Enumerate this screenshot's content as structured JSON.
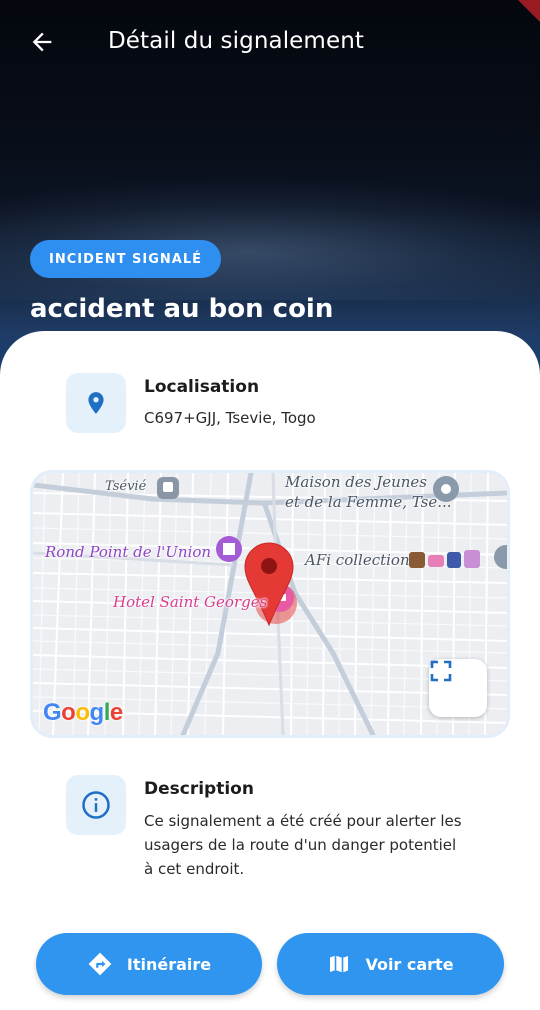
{
  "appbar": {
    "title": "Détail du signalement"
  },
  "hero": {
    "badge": "INCIDENT SIGNALÉ",
    "title": "accident au bon coin"
  },
  "location": {
    "heading": "Localisation",
    "address": "C697+GJJ, Tsevie, Togo"
  },
  "map": {
    "labels": {
      "tsevie": "Tsévié",
      "maison_line1": "Maison des Jeunes",
      "maison_line2": "et de la Femme, Tse...",
      "rond_point": "Rond Point de l'Union",
      "afi": "AFi collection",
      "hotel": "Hotel Saint Georges"
    },
    "google_logo": "Google"
  },
  "description": {
    "heading": "Description",
    "line1": "Ce signalement a été créé pour alerter les",
    "line2": "usagers de la route d'un danger potentiel",
    "line3": "à cet endroit."
  },
  "actions": {
    "itinerary": "Itinéraire",
    "view_map": "Voir carte"
  },
  "colors": {
    "accent": "#2f95ef",
    "badge": "#2f8ff0",
    "pin": "#e53935",
    "icon": "#1f6fc4"
  }
}
